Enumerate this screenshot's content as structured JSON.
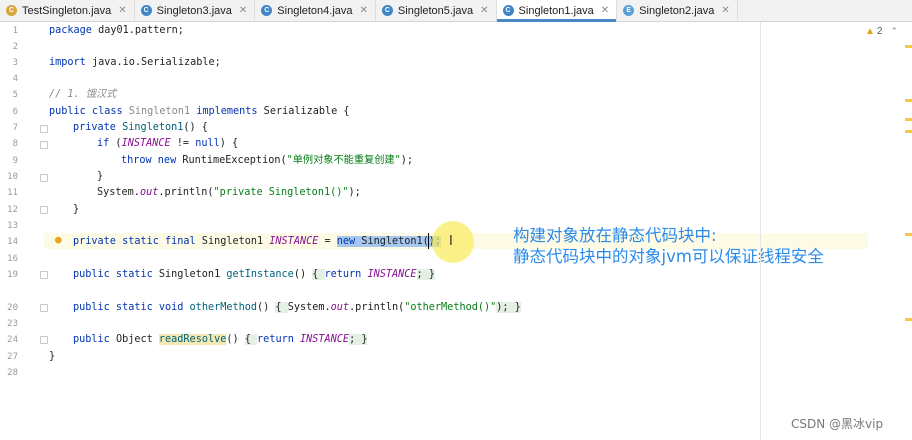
{
  "tabs": [
    {
      "label": "TestSingleton.java",
      "icon": "test-class-icon",
      "active": false
    },
    {
      "label": "Singleton3.java",
      "icon": "class-icon",
      "active": false
    },
    {
      "label": "Singleton4.java",
      "icon": "class-icon",
      "active": false
    },
    {
      "label": "Singleton5.java",
      "icon": "class-icon",
      "active": false
    },
    {
      "label": "Singleton1.java",
      "icon": "class-icon",
      "active": true
    },
    {
      "label": "Singleton2.java",
      "icon": "enum-icon",
      "active": false
    }
  ],
  "line_numbers": [
    "1",
    "2",
    "3",
    "4",
    "5",
    "6",
    "7",
    "8",
    "9",
    "10",
    "11",
    "12",
    "13",
    "14",
    "16",
    "19",
    "20",
    "23",
    "24",
    "27",
    "28"
  ],
  "code": {
    "l1": {
      "kw": "package",
      "rest": " day01.pattern;"
    },
    "l3": {
      "kw": "import",
      "rest": " java.io.Serializable;"
    },
    "l5": {
      "comment": "// 1. 饿汉式"
    },
    "l6": {
      "kw1": "public class",
      "cls": " Singleton1",
      "kw2": " implements",
      "rest": " Serializable {"
    },
    "l7": {
      "kw": "private",
      "fn": " Singleton1",
      "rest": "() {"
    },
    "l8": {
      "kw": "if",
      "open": " (",
      "field": "INSTANCE",
      "op": " != ",
      "kw2": "null",
      "rest": ") {"
    },
    "l9": {
      "kw": "throw new",
      "rest": " RuntimeException(",
      "str": "\"单例对象不能重复创建\"",
      "end": ");"
    },
    "l10": {
      "rest": "}"
    },
    "l11": {
      "a": "System.",
      "field": "out",
      "b": ".println(",
      "str": "\"private Singleton1()\"",
      "end": ");"
    },
    "l12": {
      "rest": "}"
    },
    "l14": {
      "kw": "private static final",
      "type": " Singleton1 ",
      "field": "INSTANCE",
      "eq": " = ",
      "sel_kw": "new",
      "sel_rest": " Singleton1();"
    },
    "l16": {
      "kw": "public static",
      "type": " Singleton1 ",
      "fn": "getInstance",
      "paren": "() ",
      "open": "{ ",
      "kw2": "return",
      "sp": " ",
      "field": "INSTANCE",
      "close": "; }"
    },
    "l20": {
      "kw": "public static void",
      "sp": " ",
      "fn": "otherMethod",
      "paren": "() ",
      "open": "{ ",
      "a": "System.",
      "field": "out",
      "b": ".println(",
      "str": "\"otherMethod()\"",
      "end": "); }"
    },
    "l24": {
      "kw": "public",
      "type": " Object ",
      "fn": "readResolve",
      "paren": "() ",
      "open": "{ ",
      "kw2": "return",
      "sp": " ",
      "field": "INSTANCE",
      "close": "; }"
    },
    "l27": {
      "rest": "}"
    }
  },
  "annotation": {
    "line1": "构建对象放在静态代码块中:",
    "line2": "静态代码块中的对象jvm可以保证线程安全"
  },
  "inspection": {
    "count": "2"
  },
  "watermark": "CSDN @黑冰vip",
  "colors": {
    "keyword": "#0033b3",
    "string": "#067d17",
    "field": "#871094",
    "annotation": "#2c8be8"
  }
}
